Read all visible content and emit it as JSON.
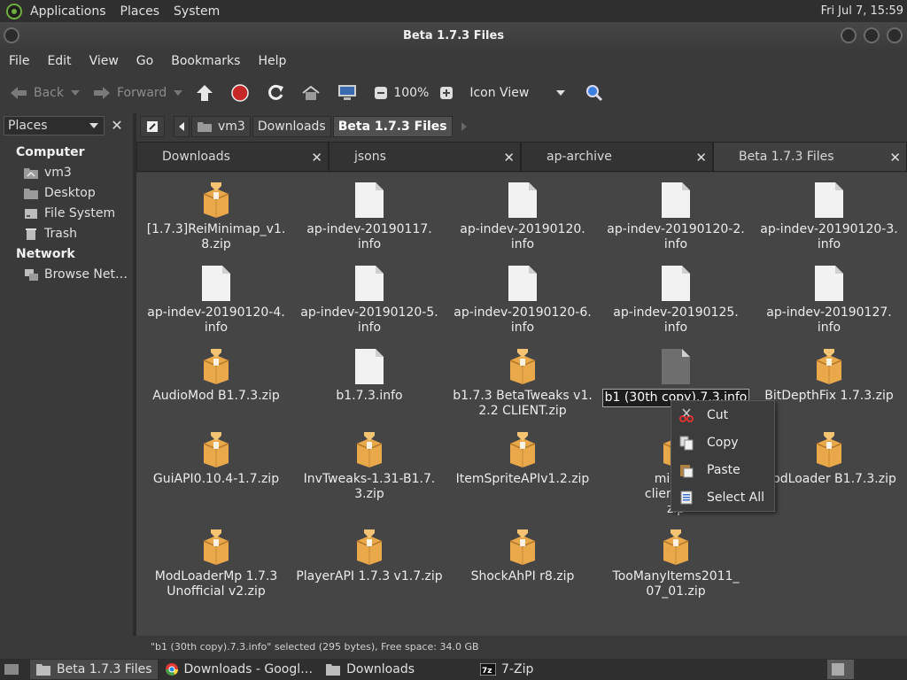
{
  "top_panel": {
    "menus": [
      "Applications",
      "Places",
      "System"
    ],
    "clock": "Fri Jul  7, 15:59"
  },
  "window": {
    "title": "Beta 1.7.3 Files"
  },
  "menubar": [
    "File",
    "Edit",
    "View",
    "Go",
    "Bookmarks",
    "Help"
  ],
  "toolbar": {
    "back_label": "Back",
    "forward_label": "Forward",
    "zoom": "100%",
    "view_mode": "Icon View"
  },
  "sidebar": {
    "title": "Places",
    "sections": [
      {
        "label": "Computer",
        "items": [
          {
            "label": "vm3",
            "icon": "home-folder-icon"
          },
          {
            "label": "Desktop",
            "icon": "desktop-folder-icon"
          },
          {
            "label": "File System",
            "icon": "drive-icon"
          },
          {
            "label": "Trash",
            "icon": "trash-icon"
          }
        ]
      },
      {
        "label": "Network",
        "items": [
          {
            "label": "Browse Net…",
            "icon": "network-icon"
          }
        ]
      }
    ]
  },
  "location": {
    "crumbs": [
      "vm3",
      "Downloads",
      "Beta 1.7.3 Files"
    ]
  },
  "tabs": [
    "Downloads",
    "jsons",
    "ap-archive",
    "Beta 1.7.3 Files"
  ],
  "files": [
    {
      "name": "[1.7.3]ReiMinimap_v1.\n8.zip",
      "type": "zip"
    },
    {
      "name": "ap-indev-20190117.\ninfo",
      "type": "doc"
    },
    {
      "name": "ap-indev-20190120.\ninfo",
      "type": "doc"
    },
    {
      "name": "ap-indev-20190120-2.\ninfo",
      "type": "doc"
    },
    {
      "name": "ap-indev-20190120-3.\ninfo",
      "type": "doc"
    },
    {
      "name": "ap-indev-20190120-4.\ninfo",
      "type": "doc"
    },
    {
      "name": "ap-indev-20190120-5.\ninfo",
      "type": "doc"
    },
    {
      "name": "ap-indev-20190120-6.\ninfo",
      "type": "doc"
    },
    {
      "name": "ap-indev-20190125.\ninfo",
      "type": "doc"
    },
    {
      "name": "ap-indev-20190127.\ninfo",
      "type": "doc"
    },
    {
      "name": "AudioMod B1.7.3.zip",
      "type": "zip"
    },
    {
      "name": "b1.7.3.info",
      "type": "doc"
    },
    {
      "name": "b1.7.3 BetaTweaks v1.\n2.2 CLIENT.zip",
      "type": "zip"
    },
    {
      "name": "b1 (30th copy).7.3.info",
      "type": "doc-selected"
    },
    {
      "name": "BitDepthFix 1.7.3.zip",
      "type": "zip"
    },
    {
      "name": "GuiAPI0.10.4-1.7.zip",
      "type": "zip"
    },
    {
      "name": "InvTweaks-1.31-B1.7.\n3.zip",
      "type": "zip"
    },
    {
      "name": "ItemSpriteAPIv1.2.zip",
      "type": "zip"
    },
    {
      "name": "minecr\nclient-1.0.\nzip",
      "type": "zip"
    },
    {
      "name": "ModLoader B1.7.3.zip",
      "type": "zip"
    },
    {
      "name": "ModLoaderMp 1.7.3\nUnofficial v2.zip",
      "type": "zip"
    },
    {
      "name": "PlayerAPI 1.7.3 v1.7.zip",
      "type": "zip"
    },
    {
      "name": "ShockAhPI r8.zip",
      "type": "zip"
    },
    {
      "name": "TooManyItems2011_\n07_01.zip",
      "type": "zip"
    }
  ],
  "context_menu": {
    "items": [
      {
        "label": "Cut",
        "icon": "cut-icon"
      },
      {
        "label": "Copy",
        "icon": "copy-icon"
      },
      {
        "label": "Paste",
        "icon": "paste-icon"
      },
      {
        "label": "Select All",
        "icon": "select-all-icon"
      }
    ]
  },
  "status": "\"b1 (30th copy).7.3.info\" selected (295 bytes), Free space: 34.0 GB",
  "taskbar": [
    {
      "label": "Beta 1.7.3 Files",
      "icon": "folder-icon",
      "active": true
    },
    {
      "label": "Downloads - Googl…",
      "icon": "chrome-icon",
      "active": false
    },
    {
      "label": "Downloads",
      "icon": "folder-icon",
      "active": false
    },
    {
      "label": "7-Zip",
      "icon": "7zip-icon",
      "active": false
    }
  ],
  "colors": {
    "zip": "#e9a84a",
    "doc": "#f2f2f2",
    "doc_selected": "#6e6e6e",
    "accent_stop": "#c62828",
    "accent_search": "#3b7ee0"
  }
}
